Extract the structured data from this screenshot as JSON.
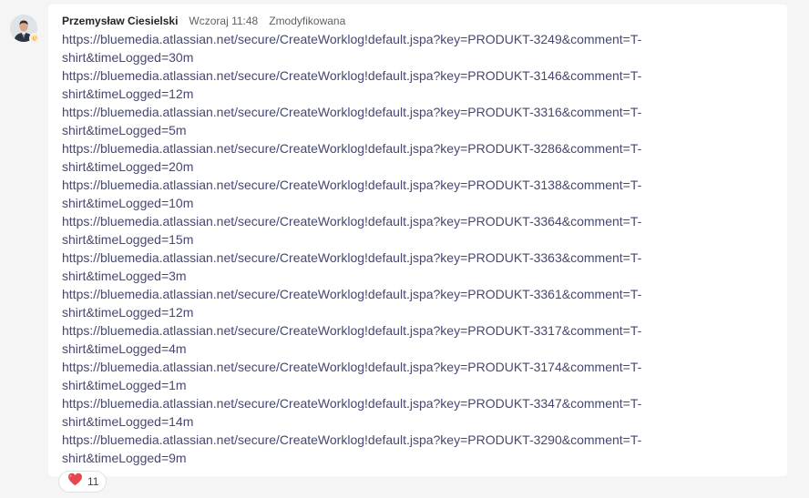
{
  "message": {
    "author": "Przemysław Ciesielski",
    "timestamp": "Wczoraj 11:48",
    "edited_label": "Zmodyfikowana",
    "links": [
      {
        "line1": "https://bluemedia.atlassian.net/secure/CreateWorklog!default.jspa?key=PRODUKT-3249&comment=T-",
        "line2": "shirt&timeLogged=30m"
      },
      {
        "line1": "https://bluemedia.atlassian.net/secure/CreateWorklog!default.jspa?key=PRODUKT-3146&comment=T-",
        "line2": "shirt&timeLogged=12m"
      },
      {
        "line1": "https://bluemedia.atlassian.net/secure/CreateWorklog!default.jspa?key=PRODUKT-3316&comment=T-",
        "line2": "shirt&timeLogged=5m"
      },
      {
        "line1": "https://bluemedia.atlassian.net/secure/CreateWorklog!default.jspa?key=PRODUKT-3286&comment=T-",
        "line2": "shirt&timeLogged=20m"
      },
      {
        "line1": "https://bluemedia.atlassian.net/secure/CreateWorklog!default.jspa?key=PRODUKT-3138&comment=T-",
        "line2": "shirt&timeLogged=10m"
      },
      {
        "line1": "https://bluemedia.atlassian.net/secure/CreateWorklog!default.jspa?key=PRODUKT-3364&comment=T-",
        "line2": "shirt&timeLogged=15m"
      },
      {
        "line1": "https://bluemedia.atlassian.net/secure/CreateWorklog!default.jspa?key=PRODUKT-3363&comment=T-",
        "line2": "shirt&timeLogged=3m"
      },
      {
        "line1": "https://bluemedia.atlassian.net/secure/CreateWorklog!default.jspa?key=PRODUKT-3361&comment=T-",
        "line2": "shirt&timeLogged=12m"
      },
      {
        "line1": "https://bluemedia.atlassian.net/secure/CreateWorklog!default.jspa?key=PRODUKT-3317&comment=T-",
        "line2": "shirt&timeLogged=4m"
      },
      {
        "line1": "https://bluemedia.atlassian.net/secure/CreateWorklog!default.jspa?key=PRODUKT-3174&comment=T-",
        "line2": "shirt&timeLogged=1m"
      },
      {
        "line1": "https://bluemedia.atlassian.net/secure/CreateWorklog!default.jspa?key=PRODUKT-3347&comment=T-",
        "line2": "shirt&timeLogged=14m"
      },
      {
        "line1": "https://bluemedia.atlassian.net/secure/CreateWorklog!default.jspa?key=PRODUKT-3290&comment=T-",
        "line2": "shirt&timeLogged=9m"
      }
    ]
  },
  "reaction": {
    "icon": "heart-icon",
    "count": "11"
  },
  "colors": {
    "link": "#464775",
    "presence_away": "#f8b73a",
    "heart": "#e8464f",
    "background": "#f5f5f5",
    "bubble": "#ffffff"
  }
}
